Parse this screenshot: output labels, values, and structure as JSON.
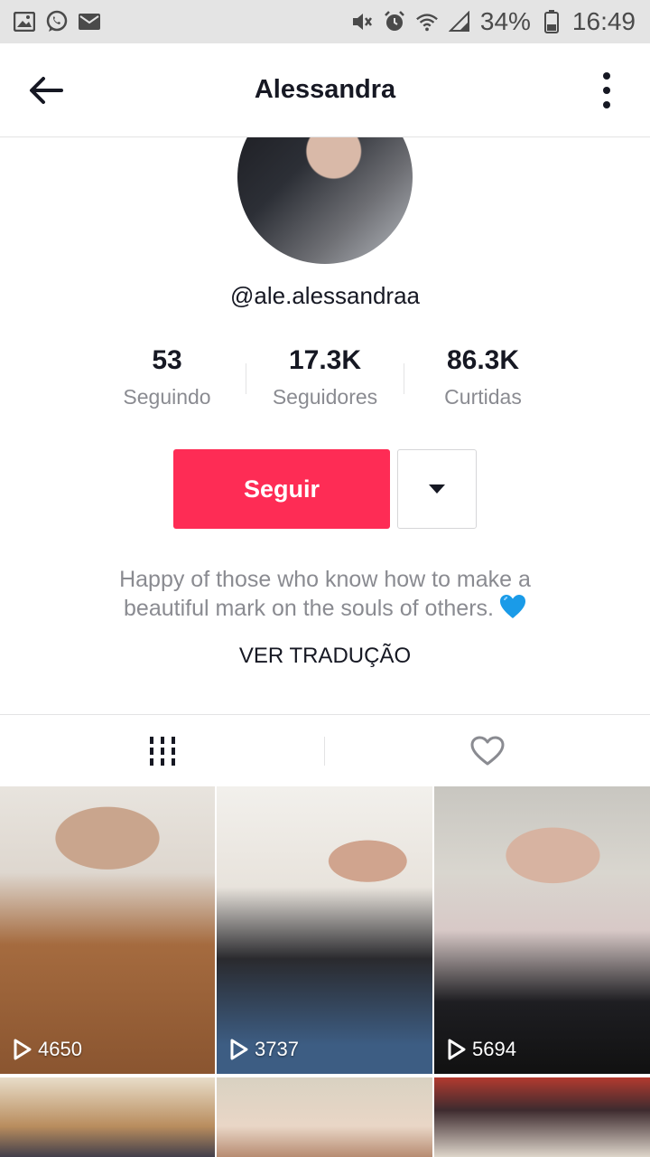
{
  "status_bar": {
    "battery": "34%",
    "time": "16:49",
    "left_icons": [
      "gallery-icon",
      "whatsapp-icon",
      "mail-icon"
    ],
    "right_icons": [
      "mute-icon",
      "alarm-icon",
      "wifi-icon",
      "signal-icon",
      "battery-icon"
    ]
  },
  "header": {
    "title": "Alessandra"
  },
  "profile": {
    "username": "@ale.alessandraa",
    "stats": [
      {
        "value": "53",
        "label": "Seguindo"
      },
      {
        "value": "17.3K",
        "label": "Seguidores"
      },
      {
        "value": "86.3K",
        "label": "Curtidas"
      }
    ],
    "follow_label": "Seguir",
    "bio_line1": "Happy of those who know how to make a",
    "bio_line2": "beautiful mark on the souls of others.",
    "translate_label": "VER TRADUÇÃO"
  },
  "tabs": [
    {
      "name": "videos",
      "icon": "grid-icon",
      "active": true
    },
    {
      "name": "liked",
      "icon": "heart-icon",
      "active": false
    }
  ],
  "videos": [
    {
      "views": "4650"
    },
    {
      "views": "3737"
    },
    {
      "views": "5694"
    }
  ],
  "colors": {
    "accent": "#fe2c55",
    "text": "#161823",
    "muted": "#8a8b91",
    "status_bar_bg": "#e4e4e4"
  }
}
